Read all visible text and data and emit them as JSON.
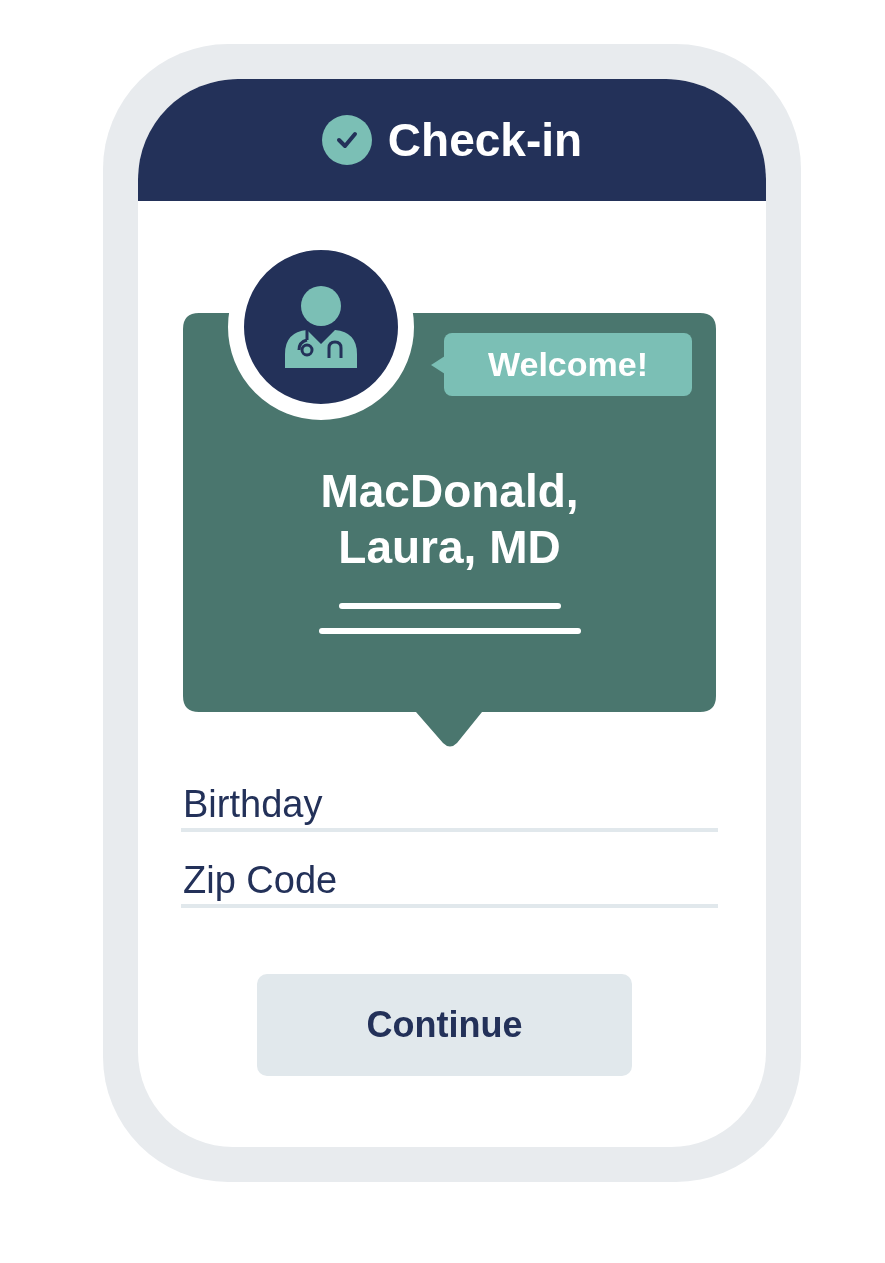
{
  "header": {
    "title": "Check-in"
  },
  "card": {
    "badge": "Welcome!",
    "name": "MacDonald, Laura, MD"
  },
  "fields": [
    {
      "placeholder": "Birthday"
    },
    {
      "placeholder": "Zip Code"
    }
  ],
  "button": {
    "label": "Continue"
  }
}
